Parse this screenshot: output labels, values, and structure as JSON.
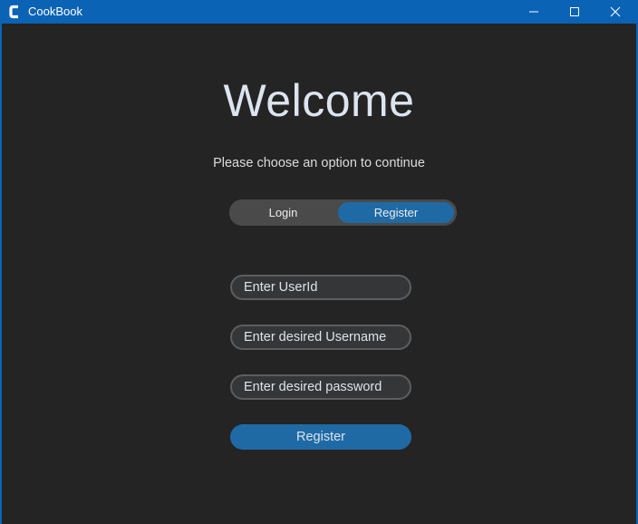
{
  "window": {
    "title": "CookBook",
    "accent_color": "#0b63b5",
    "icons": {
      "app": "cookbook-logo-icon",
      "minimize": "minimize-icon",
      "maximize": "maximize-icon",
      "close": "close-icon"
    }
  },
  "main": {
    "heading": "Welcome",
    "subtitle": "Please choose an option to continue",
    "tabs": [
      {
        "label": "Login",
        "selected": false
      },
      {
        "label": "Register",
        "selected": true
      }
    ],
    "form": {
      "userid_placeholder": "Enter UserId",
      "username_placeholder": "Enter desired Username",
      "password_placeholder": "Enter desired password",
      "submit_label": "Register"
    },
    "colors": {
      "background": "#242424",
      "button": "#1f6aa5",
      "field": "#343638"
    }
  }
}
